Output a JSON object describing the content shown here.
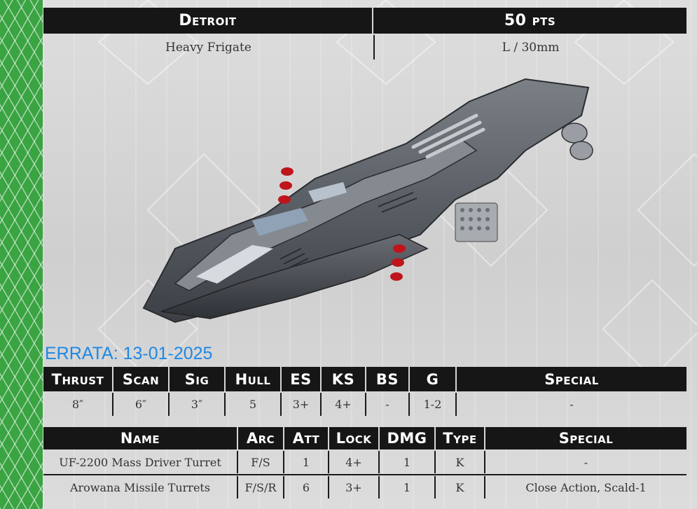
{
  "ship": {
    "name": "Detroit",
    "points": "50 pts",
    "class": "Heavy Frigate",
    "size": "L / 30mm"
  },
  "errata": "ERRATA: 13-01-2025",
  "stats": {
    "headers": [
      "Thrust",
      "Scan",
      "Sig",
      "Hull",
      "ES",
      "KS",
      "BS",
      "G",
      "Special"
    ],
    "values": [
      "8″",
      "6″",
      "3″",
      "5",
      "3+",
      "4+",
      "-",
      "1-2",
      "-"
    ]
  },
  "weapons": {
    "headers": [
      "Name",
      "Arc",
      "Att",
      "Lock",
      "DMG",
      "Type",
      "Special"
    ],
    "rows": [
      [
        "UF-2200 Mass Driver Turret",
        "F/S",
        "1",
        "4+",
        "1",
        "K",
        "-"
      ],
      [
        "Arowana Missile Turrets",
        "F/S/R",
        "6",
        "3+",
        "1",
        "K",
        "Close Action, Scald-1"
      ]
    ]
  },
  "colors": {
    "stripe": "#3aa342",
    "header_bg": "#161616",
    "errata": "#1e88e5",
    "missile_tip": "#c0141c"
  }
}
